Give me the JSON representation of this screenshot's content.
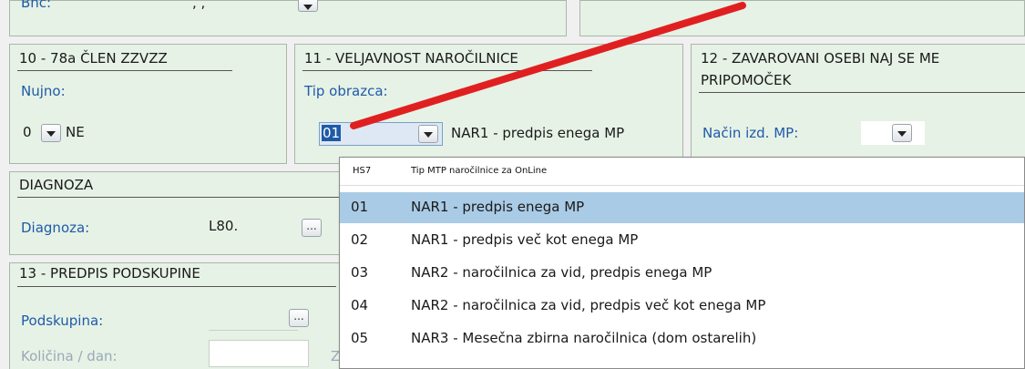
{
  "top_section": {
    "label_partial": "Bnc:",
    "value_partial": ", ,"
  },
  "section_10": {
    "title": "10 - 78a ČLEN ZZVZZ",
    "nujno_label": "Nujno:",
    "nujno_value": "0",
    "nujno_text": "NE"
  },
  "section_11": {
    "title": "11 - VELJAVNOST NAROČILNICE",
    "tip_label": "Tip obrazca:",
    "tip_value": "01",
    "tip_text": "NAR1 - predpis enega MP"
  },
  "section_12": {
    "title_line1": "12 - ZAVAROVANI OSEBI NAJ SE ME",
    "title_line2": "PRIPOMOČEK",
    "nacin_label": "Način izd. MP:"
  },
  "diagnoza": {
    "title": "DIAGNOZA",
    "label": "Diagnoza:",
    "value": "L80.",
    "ellipsis": "..."
  },
  "section_13": {
    "title": "13 - PREDPIS PODSKUPINE",
    "podskupina_label": "Podskupina:",
    "kolicina_label": "Količina / dan:",
    "ellipsis": "...",
    "partial_letter": "Z"
  },
  "dropdown": {
    "header_code": "HS7",
    "header_name": "Tip MTP naročilnice za OnLine",
    "rows": [
      {
        "code": "01",
        "name": "NAR1 - predpis enega MP"
      },
      {
        "code": "02",
        "name": "NAR1 - predpis več kot enega MP"
      },
      {
        "code": "03",
        "name": "NAR2 - naročilnica za vid, predpis enega MP"
      },
      {
        "code": "04",
        "name": "NAR2 - naročilnica za vid, predpis več kot enega MP"
      },
      {
        "code": "05",
        "name": "NAR3 - Mesečna zbirna naročilnica (dom ostarelih)"
      }
    ],
    "selected_index": 0
  },
  "colors": {
    "group_bg": "#e6f2e6",
    "label_blue": "#1f5aa8",
    "selection": "#a9cbe6",
    "annotation_arrow": "#e02020"
  },
  "icons": [
    "dropdown-arrow-icon",
    "ellipsis-button-icon"
  ]
}
